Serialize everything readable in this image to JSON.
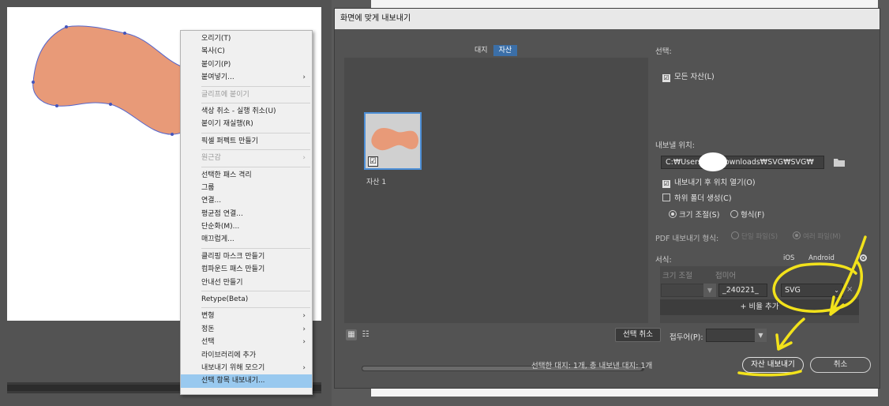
{
  "context_menu": {
    "items": [
      {
        "label": "오리기(T)",
        "disabled": false
      },
      {
        "label": "복사(C)",
        "disabled": false
      },
      {
        "label": "붙이기(P)",
        "disabled": false
      },
      {
        "label": "붙여넣기...",
        "disabled": false,
        "submenu": true
      },
      {
        "label": "글리프에 붙이기",
        "disabled": true
      },
      {
        "label": "색상 취소 - 실행 취소(U)",
        "disabled": false
      },
      {
        "label": "붙이기 재실행(R)",
        "disabled": false
      },
      {
        "label": "픽셀 퍼펙트 만들기",
        "disabled": false
      },
      {
        "label": "원근감",
        "disabled": true,
        "submenu": true
      },
      {
        "label": "선택한 패스 격리",
        "disabled": false
      },
      {
        "label": "그룹",
        "disabled": false
      },
      {
        "label": "연결...",
        "disabled": false
      },
      {
        "label": "평균점 연결...",
        "disabled": false
      },
      {
        "label": "단순화(M)...",
        "disabled": false
      },
      {
        "label": "매끄럽게...",
        "disabled": false
      },
      {
        "label": "클리핑 마스크 만들기",
        "disabled": false
      },
      {
        "label": "컴파운드 패스 만들기",
        "disabled": false
      },
      {
        "label": "안내선 만들기",
        "disabled": false
      },
      {
        "label": "Retype(Beta)",
        "disabled": false
      },
      {
        "label": "변형",
        "disabled": false,
        "submenu": true
      },
      {
        "label": "정돈",
        "disabled": false,
        "submenu": true
      },
      {
        "label": "선택",
        "disabled": false,
        "submenu": true
      },
      {
        "label": "라이브러리에 추가",
        "disabled": false
      },
      {
        "label": "내보내기 위해 모으기",
        "disabled": false,
        "submenu": true
      },
      {
        "label": "선택 항목 내보내기...",
        "disabled": false,
        "selected": true
      }
    ],
    "submenu_arrow": "›"
  },
  "dialog": {
    "title": "화면에 맞게 내보내기",
    "tabs": [
      "대지",
      "자산"
    ],
    "active_tab": "자산",
    "asset_name": "자산 1",
    "selection_label": "선택:",
    "all_assets_label": "모든 자산(L)",
    "export_location_label": "내보낼 위치:",
    "path_value": "C:₩Users₩        ₩Downloads₩SVG₩SVG₩",
    "open_after_export_label": "내보내기 후 위치 열기(O)",
    "create_subfolders_label": "하위 폴더 생성(C)",
    "scale_option_label": "크기 조절(S)",
    "format_option_label": "형식(F)",
    "pdf_export_label": "PDF 내보내기 형식:",
    "pdf_single_label": "단일 파일(S)",
    "pdf_multi_label": "여러 파일(M)",
    "formats_label": "서식:",
    "ios_label": "iOS",
    "android_label": "Android",
    "col_scale": "크기 조절",
    "col_suffix": "접미어",
    "suffix_value": "_240221_",
    "format_value": "SVG",
    "add_scale_label": "+ 비율 추가",
    "cancel_selection_label": "선택 취소",
    "prefix_label": "접두어(P):",
    "status_text": "선택한 대지: 1개, 총 내보낸 대지: 1개",
    "export_button": "자산 내보내기",
    "cancel_button": "취소",
    "checks": {
      "all_assets": "☑",
      "open_after": "☑",
      "thumb": "☑"
    }
  },
  "colors": {
    "blob_fill": "#e89a78",
    "blob_stroke": "#5566cc",
    "annotation": "#f2e21b",
    "selection": "#99c9ef",
    "tab_active": "#3b6fa8"
  },
  "icons": {
    "folder": "folder-icon",
    "gear": "gear-icon",
    "grid_view": "grid-view-icon",
    "list_view": "list-view-icon"
  }
}
